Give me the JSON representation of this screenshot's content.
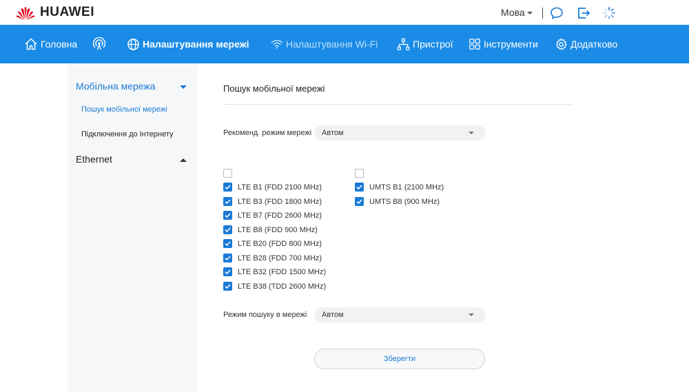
{
  "brand": {
    "name": "HUAWEI",
    "color": "#e4001b"
  },
  "header": {
    "language_label": "Мова",
    "icons": [
      "chat-icon",
      "logout-icon",
      "loading-icon"
    ]
  },
  "nav": {
    "accent_color": "#1a8be6",
    "items": [
      {
        "label": "Головна",
        "icon": "home-icon"
      },
      {
        "label": "",
        "icon": "signal-icon"
      },
      {
        "label": "Налаштування мережі",
        "icon": "globe-icon",
        "active": true
      },
      {
        "label": "Налаштування Wi-Fi",
        "icon": "wifi-icon"
      },
      {
        "label": "Пристрої",
        "icon": "devices-icon"
      },
      {
        "label": "Інструменти",
        "icon": "tools-icon"
      },
      {
        "label": "Додатково",
        "icon": "gear-icon"
      }
    ]
  },
  "sidebar": {
    "groups": [
      {
        "label": "Мобільна мережа",
        "expanded": true,
        "items": [
          "Пошук мобільної мережі",
          "Підключення до Інтернету"
        ]
      },
      {
        "label": "Ethernet",
        "expanded": false
      }
    ]
  },
  "content": {
    "title": "Пошук мобільної мережі",
    "preferred_mode": {
      "label": "Рекоменд. режим мережі",
      "value": "Автом"
    },
    "lte_bands": [
      {
        "label": "",
        "checked": false
      },
      {
        "label": "LTE B1 (FDD 2100 MHz)",
        "checked": true
      },
      {
        "label": "LTE B3 (FDD 1800 MHz)",
        "checked": true
      },
      {
        "label": "LTE B7 (FDD 2600 MHz)",
        "checked": true
      },
      {
        "label": "LTE B8 (FDD 900 MHz)",
        "checked": true
      },
      {
        "label": "LTE B20 (FDD 800 MHz)",
        "checked": true
      },
      {
        "label": "LTE B28 (FDD 700 MHz)",
        "checked": true
      },
      {
        "label": "LTE B32 (FDD 1500 MHz)",
        "checked": true
      },
      {
        "label": "LTE B38 (TDD 2600 MHz)",
        "checked": true
      }
    ],
    "umts_bands": [
      {
        "label": "",
        "checked": false
      },
      {
        "label": "UMTS B1 (2100 MHz)",
        "checked": true
      },
      {
        "label": "UMTS B8 (900 MHz)",
        "checked": true
      }
    ],
    "search_mode": {
      "label": "Режим пошуку в мережі",
      "value": "Автом"
    },
    "save_label": "Зберегти"
  }
}
